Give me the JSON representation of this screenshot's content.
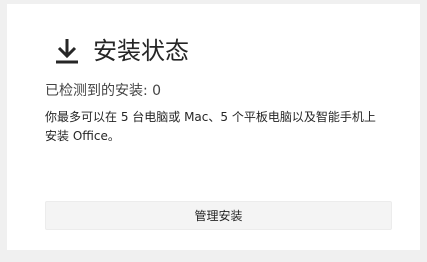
{
  "header": {
    "title": "安装状态",
    "icon": "download-icon"
  },
  "status": {
    "detected_text": "已检测到的安装: 0"
  },
  "info": {
    "description": "你最多可以在 5 台电脑或 Mac、5 个平板电脑以及智能手机上安装 Office。"
  },
  "actions": {
    "manage_label": "管理安装"
  },
  "colors": {
    "background": "#f0f0f0",
    "card": "#ffffff",
    "text": "#262626",
    "button": "#f4f4f4"
  }
}
